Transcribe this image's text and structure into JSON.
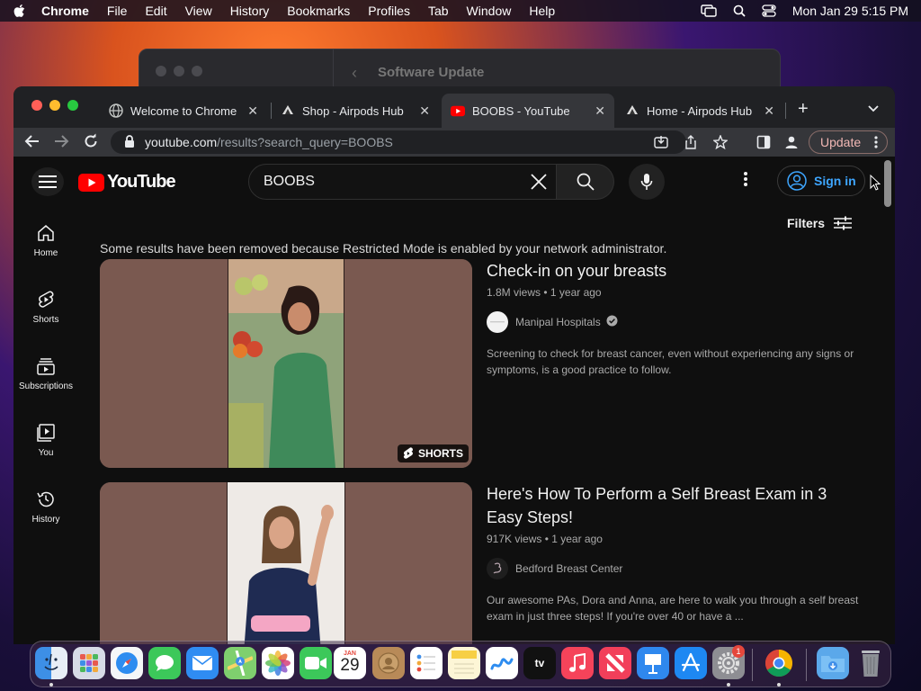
{
  "menubar": {
    "app": "Chrome",
    "items": [
      "File",
      "Edit",
      "View",
      "History",
      "Bookmarks",
      "Profiles",
      "Tab",
      "Window",
      "Help"
    ],
    "datetime": "Mon Jan 29  5:15 PM"
  },
  "bg_window": {
    "title": "Software Update"
  },
  "tabs": [
    {
      "title": "Welcome to Chrome",
      "icon": "chrome-globe-icon"
    },
    {
      "title": "Shop - Airpods Hub",
      "icon": "airpods-hub-icon"
    },
    {
      "title": "BOOBS - YouTube",
      "icon": "youtube-icon",
      "active": true
    },
    {
      "title": "Home - Airpods Hub",
      "icon": "airpods-hub-icon"
    }
  ],
  "omnibox": {
    "host": "youtube.com",
    "path": "/results?search_query=BOOBS"
  },
  "update_label": "Update",
  "youtube": {
    "logo_text": "YouTube",
    "search_value": "BOOBS",
    "sign_in": "Sign in",
    "filters": "Filters",
    "guide": [
      {
        "label": "Home",
        "icon": "home-icon"
      },
      {
        "label": "Shorts",
        "icon": "shorts-icon"
      },
      {
        "label": "Subscriptions",
        "icon": "subscriptions-icon"
      },
      {
        "label": "You",
        "icon": "you-icon"
      },
      {
        "label": "History",
        "icon": "history-icon"
      }
    ],
    "notice": "Some results have been removed because Restricted Mode is enabled by your network administrator.",
    "results": [
      {
        "title": "Check-in on your breasts",
        "info": "1.8M views • 1 year ago",
        "channel": "Manipal Hospitals",
        "desc": "Screening to check for breast cancer, even without experiencing any signs or symptoms, is a good practice to follow.",
        "badge": "SHORTS"
      },
      {
        "title": "Here's How To Perform a Self Breast Exam in 3 Easy Steps!",
        "info": "917K views • 1 year ago",
        "channel": "Bedford Breast Center",
        "desc": "Our awesome PAs, Dora and Anna, are here to walk you through a self breast exam in just three steps! If you're over 40 or have a ..."
      }
    ]
  },
  "dock": {
    "calendar_month": "JAN",
    "calendar_day": "29",
    "settings_badge": "1",
    "tv_label": "tv"
  },
  "colors": {
    "youtube_red": "#ff0000",
    "link_blue": "#3ea6ff"
  }
}
